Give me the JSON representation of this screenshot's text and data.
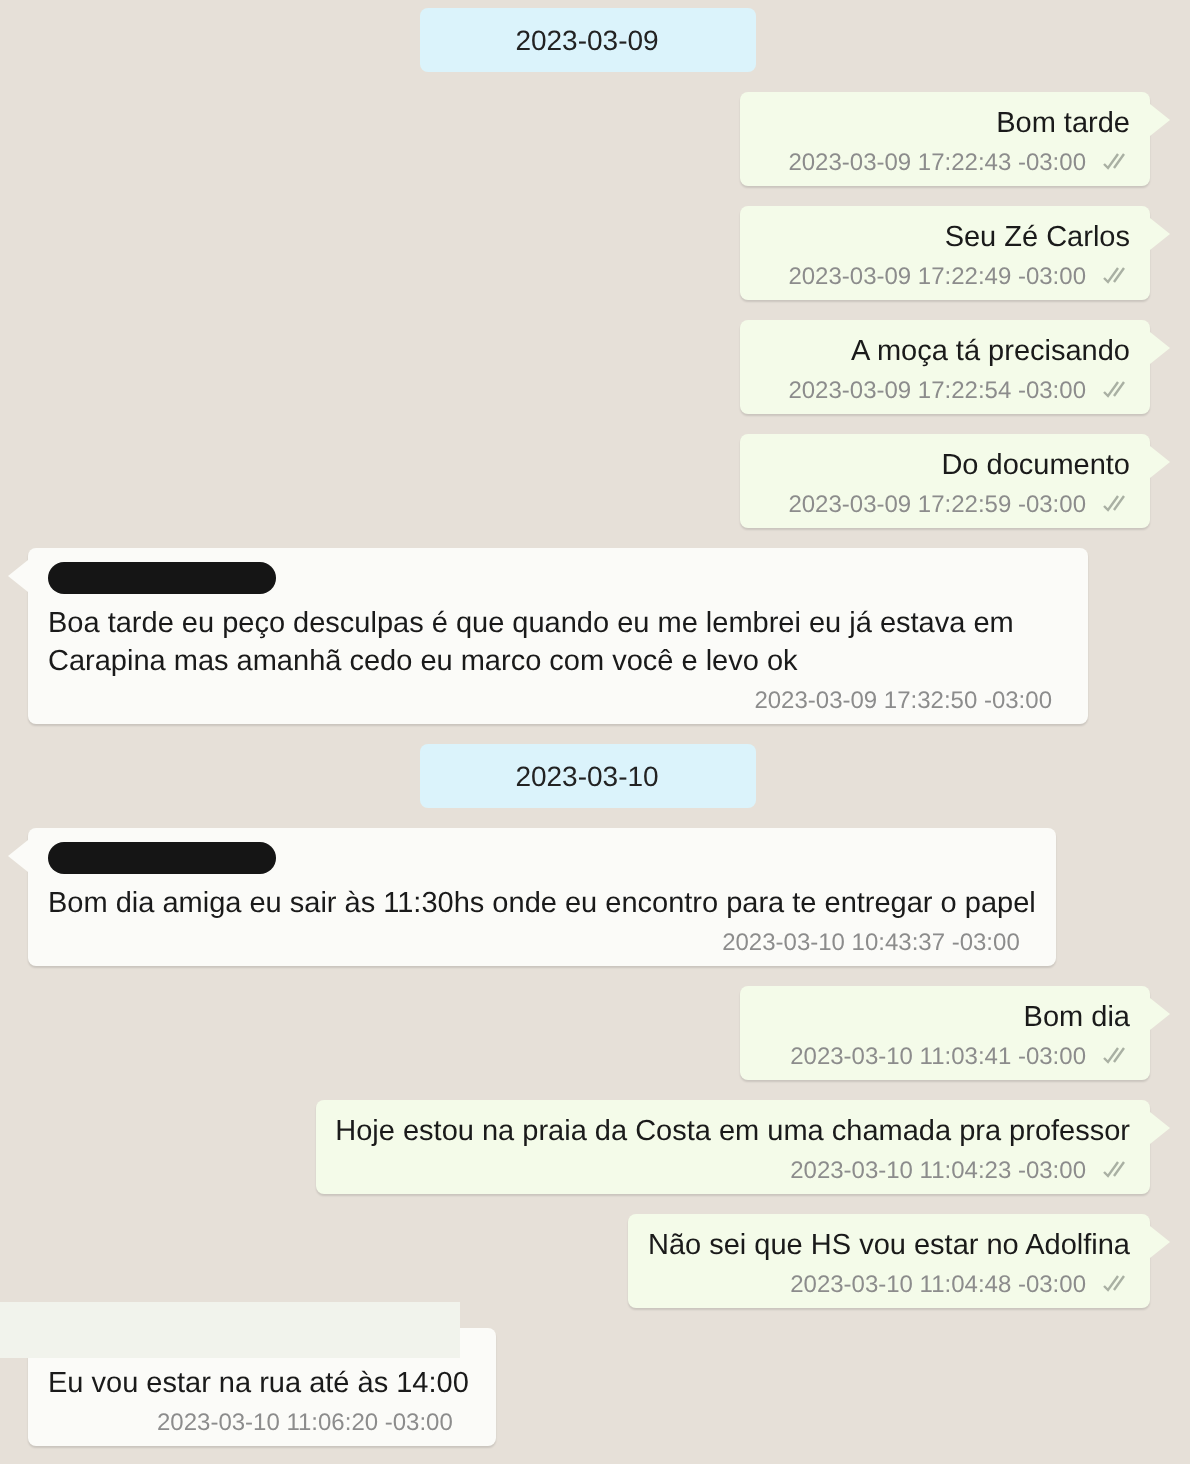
{
  "items": [
    {
      "kind": "date",
      "text": "2023-03-09"
    },
    {
      "kind": "out",
      "text": "Bom tarde",
      "time": "2023-03-09 17:22:43 -03:00"
    },
    {
      "kind": "out",
      "text": "Seu Zé Carlos",
      "time": "2023-03-09 17:22:49 -03:00"
    },
    {
      "kind": "out",
      "text": "A moça tá precisando",
      "time": "2023-03-09 17:22:54 -03:00"
    },
    {
      "kind": "out",
      "text": "Do documento",
      "time": "2023-03-09 17:22:59 -03:00"
    },
    {
      "kind": "in",
      "redacted_sender": true,
      "text": "Boa tarde eu peço desculpas é que quando eu me lembrei eu já estava em Carapina mas amanhã cedo eu marco com você e levo ok",
      "time": "2023-03-09 17:32:50 -03:00"
    },
    {
      "kind": "date",
      "text": "2023-03-10"
    },
    {
      "kind": "in",
      "redacted_sender": true,
      "text": "Bom dia amiga eu sair às 11:30hs onde eu encontro para te entregar o papel",
      "time": "2023-03-10 10:43:37 -03:00"
    },
    {
      "kind": "out",
      "text": "Bom dia",
      "time": "2023-03-10 11:03:41 -03:00"
    },
    {
      "kind": "out",
      "text": "Hoje estou na praia da Costa em uma chamada pra professor",
      "time": "2023-03-10 11:04:23 -03:00"
    },
    {
      "kind": "out",
      "text": "Não sei que HS vou estar no Adolfina",
      "time": "2023-03-10 11:04:48 -03:00"
    },
    {
      "kind": "in",
      "erased_sender": true,
      "text": "Eu vou estar na rua até às 14:00",
      "time": "2023-03-10 11:06:20 -03:00"
    }
  ]
}
